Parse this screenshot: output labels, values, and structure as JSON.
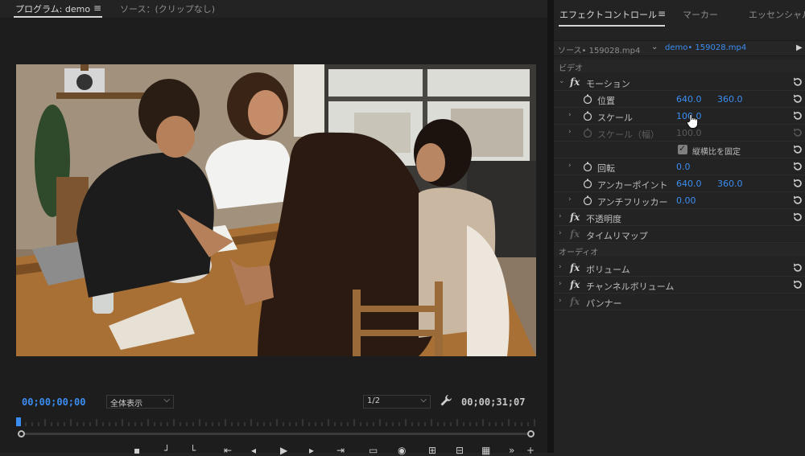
{
  "program_monitor": {
    "tab_program": "プログラム: demo",
    "tab_source": "ソース：(クリップなし)",
    "timecode_current": "00;00;00;00",
    "zoom_value": "全体表示",
    "resolution_value": "1/2",
    "timecode_duration": "00;00;31;07"
  },
  "effect_controls": {
    "tab_effect_controls": "エフェクトコントロール",
    "tab_marker": "マーカー",
    "tab_essential": "エッセンシャル",
    "source_label": "ソース• 159028.mp4",
    "sequence_label": "demo• 159028.mp4",
    "section_video": "ビデオ",
    "motion": {
      "label": "モーション",
      "position": {
        "label": "位置",
        "x": "640.0",
        "y": "360.0"
      },
      "scale": {
        "label": "スケール",
        "value": "100.0"
      },
      "scale_width": {
        "label": "スケール（幅）",
        "value": "100.0"
      },
      "uniform_scale": "縦横比を固定",
      "rotation": {
        "label": "回転",
        "value": "0.0"
      },
      "anchor": {
        "label": "アンカーポイント",
        "x": "640.0",
        "y": "360.0"
      },
      "anti_flicker": {
        "label": "アンチフリッカー",
        "value": "0.00"
      }
    },
    "opacity": "不透明度",
    "time_remap": "タイムリマップ",
    "section_audio": "オーディオ",
    "volume": "ボリューム",
    "channel_volume": "チャンネルボリューム",
    "panner": "パンナー"
  },
  "colors": {
    "accent_blue": "#3b8df1",
    "panel_bg": "#232323"
  }
}
